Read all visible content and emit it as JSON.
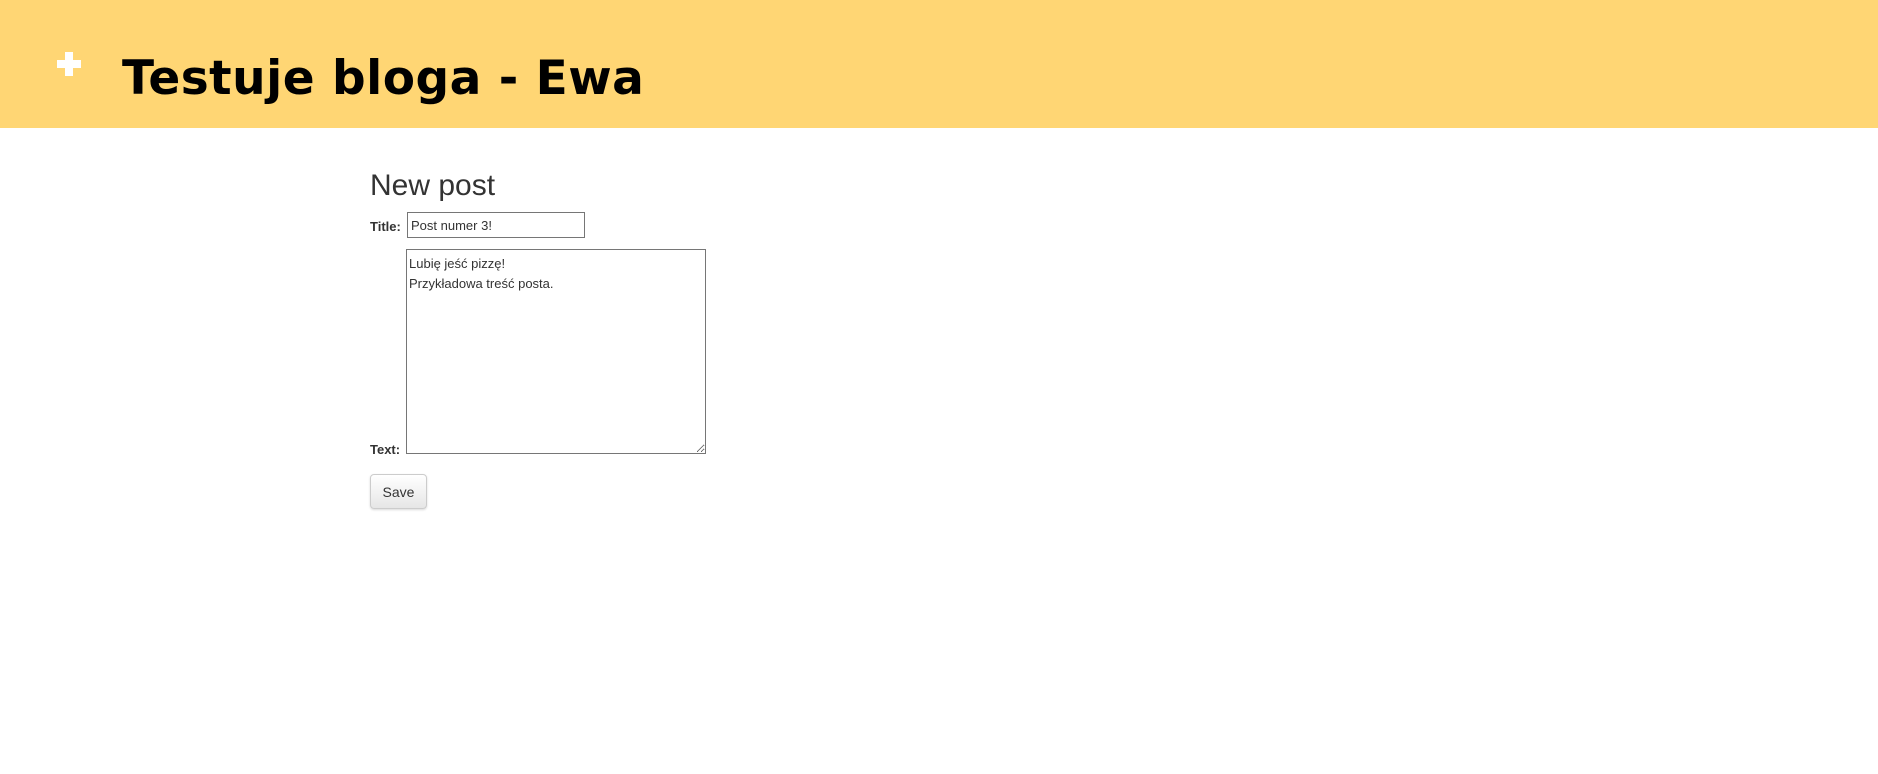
{
  "header": {
    "title": "Testuje bloga - Ewa",
    "add_icon": "plus-icon",
    "background_color": "#ffd674"
  },
  "main": {
    "heading": "New post",
    "form": {
      "title_label": "Title:",
      "title_value": "Post numer 3!",
      "text_label": "Text:",
      "text_value": "Lubię jeść pizzę!\nPrzykładowa treść posta.",
      "save_label": "Save"
    }
  }
}
